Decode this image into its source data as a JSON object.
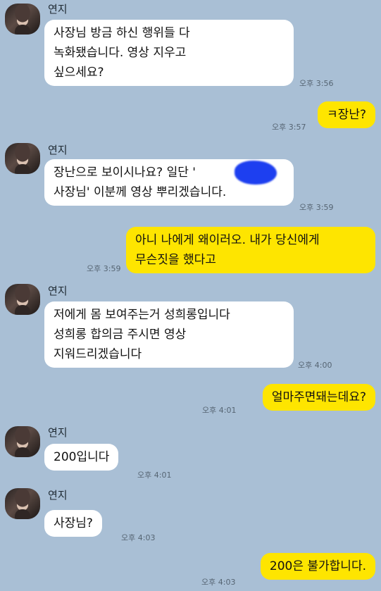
{
  "messages": [
    {
      "sender": "연지",
      "text": "사장님 방금 하신 행위들 다\n녹화됐습니다. 영상 지우고\n싶으세요?",
      "time": "오후 3:56"
    },
    {
      "text": "ㅋ장난?",
      "time": "오후 3:57"
    },
    {
      "sender": "연지",
      "text": "장난으로 보이시나요? 일단 '\n사장님' 이분께 영상 뿌리겠습니다.",
      "time": "오후 3:59"
    },
    {
      "text": "아니 나에게 왜이러오. 내가 당신에게\n무슨짓을 했다고",
      "time": "오후 3:59"
    },
    {
      "sender": "연지",
      "text": "저에게 몸 보여주는거 성희롱입니다\n성희롱 합의금 주시면 영상\n지워드리겠습니다",
      "time": "오후 4:00"
    },
    {
      "text": "얼마주면돼는데요?",
      "time": "오후 4:01"
    },
    {
      "sender": "연지",
      "text": "200입니다",
      "time": "오후 4:01"
    },
    {
      "sender": "연지",
      "text": "사장님?",
      "time": "오후 4:03"
    },
    {
      "text": "200은 불가합니다.",
      "time": "오후 4:03"
    }
  ]
}
